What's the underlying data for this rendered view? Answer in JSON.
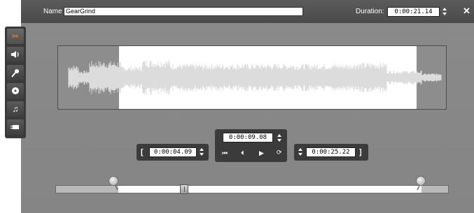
{
  "header": {
    "name_label": "Name",
    "name_value": "GearGrind",
    "duration_label": "Duration:",
    "duration_value": "0:00:21.14",
    "close_glyph": "✕"
  },
  "toolbar": {
    "tools": [
      {
        "name": "scissors-icon",
        "glyph": "✂",
        "active": true
      },
      {
        "name": "speaker-icon",
        "glyph": "🔊",
        "active": false
      },
      {
        "name": "microphone-icon",
        "glyph": "🎤",
        "active": false
      },
      {
        "name": "disc-icon",
        "glyph": "◉",
        "active": false
      },
      {
        "name": "music-note-icon",
        "glyph": "♫",
        "active": false
      },
      {
        "name": "audio-plug-icon",
        "glyph": "▭",
        "active": false
      }
    ]
  },
  "transport": {
    "mark_in": "0:00:04.09",
    "current": "0:00:09.08",
    "mark_out": "0:00:25.22",
    "bracket_in": "[",
    "bracket_out": "]",
    "buttons": {
      "start": "⏮",
      "prev": "⏴",
      "play": "▶",
      "loop": "⟳"
    }
  },
  "colors": {
    "accent_orange": "#ff8a1a",
    "panel": "#8a8a8a",
    "header": "#4f4f4f",
    "waveform": "#dcdcdc"
  }
}
